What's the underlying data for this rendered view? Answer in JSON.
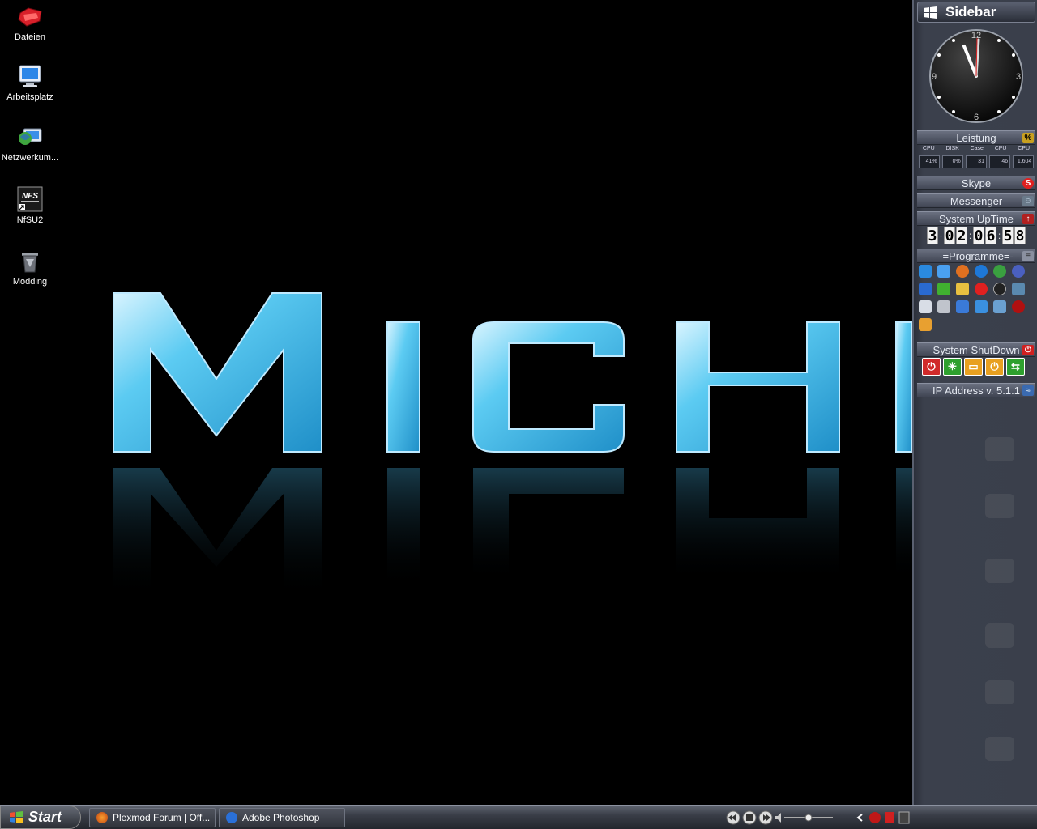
{
  "desktop": {
    "icons": [
      {
        "label": "Dateien",
        "icon": "red-folder-icon"
      },
      {
        "label": "Arbeitsplatz",
        "icon": "computer-icon"
      },
      {
        "label": "Netzwerkum...",
        "icon": "network-icon"
      },
      {
        "label": "NfSU2",
        "icon": "nfs-game-icon"
      },
      {
        "label": "Modding",
        "icon": "recycle-bin-icon"
      }
    ],
    "wallpaper_text": "MICH"
  },
  "sidebar": {
    "title": "Sidebar",
    "clock": {
      "numbers": [
        "12",
        "3",
        "6",
        "9"
      ]
    },
    "performance": {
      "title": "Leistung",
      "labels": [
        "CPU",
        "DISK",
        "Case",
        "CPU",
        "CPU"
      ],
      "values": [
        "41%",
        "0%",
        "31",
        "46",
        "1.604"
      ]
    },
    "skype": {
      "title": "Skype"
    },
    "messenger": {
      "title": "Messenger"
    },
    "uptime": {
      "title": "System UpTime",
      "digits": [
        "3",
        "0",
        "2",
        "0",
        "6",
        "5",
        "8"
      ]
    },
    "programs": {
      "title": "-=Programme=-"
    },
    "shutdown": {
      "title": "System ShutDown"
    },
    "ip": {
      "title": "IP Address v. 5.1.1"
    }
  },
  "taskbar": {
    "start_label": "Start",
    "tasks": [
      {
        "label": "Plexmod Forum | Off...",
        "icon": "firefox-icon"
      },
      {
        "label": "Adobe Photoshop",
        "icon": "photoshop-icon"
      }
    ]
  },
  "colors": {
    "wallpaper_letters": "#5ccbf2",
    "sidebar_bg": "#3a3f4b",
    "taskbar_bg": "#3a3e48"
  }
}
